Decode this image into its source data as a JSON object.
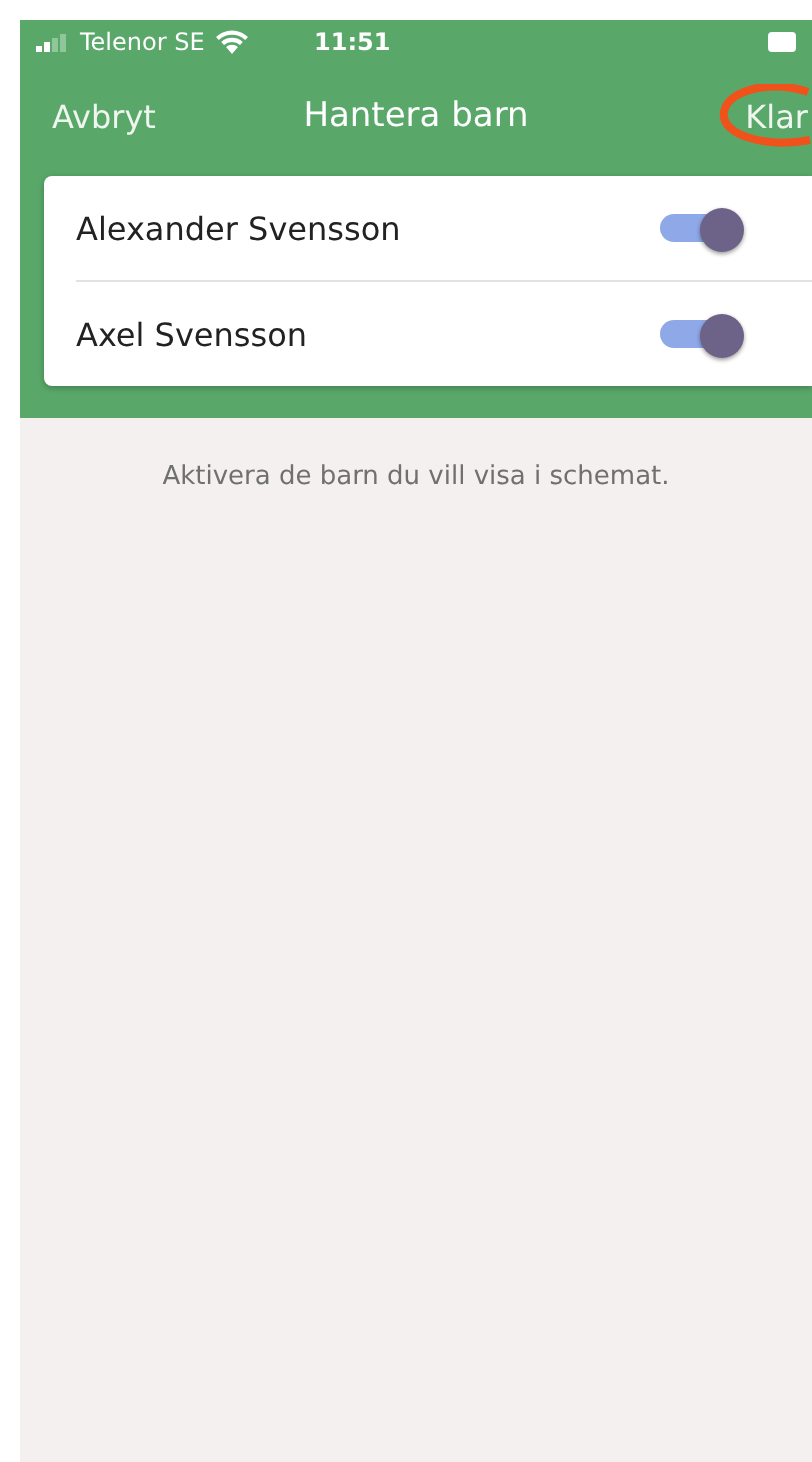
{
  "status_bar": {
    "carrier": "Telenor SE",
    "time": "11:51"
  },
  "nav": {
    "cancel": "Avbryt",
    "title": "Hantera barn",
    "done": "Klar"
  },
  "children": [
    {
      "name": "Alexander Svensson",
      "on": true
    },
    {
      "name": "Axel Svensson",
      "on": true
    }
  ],
  "hint": "Aktivera de barn du vill visa i schemat."
}
